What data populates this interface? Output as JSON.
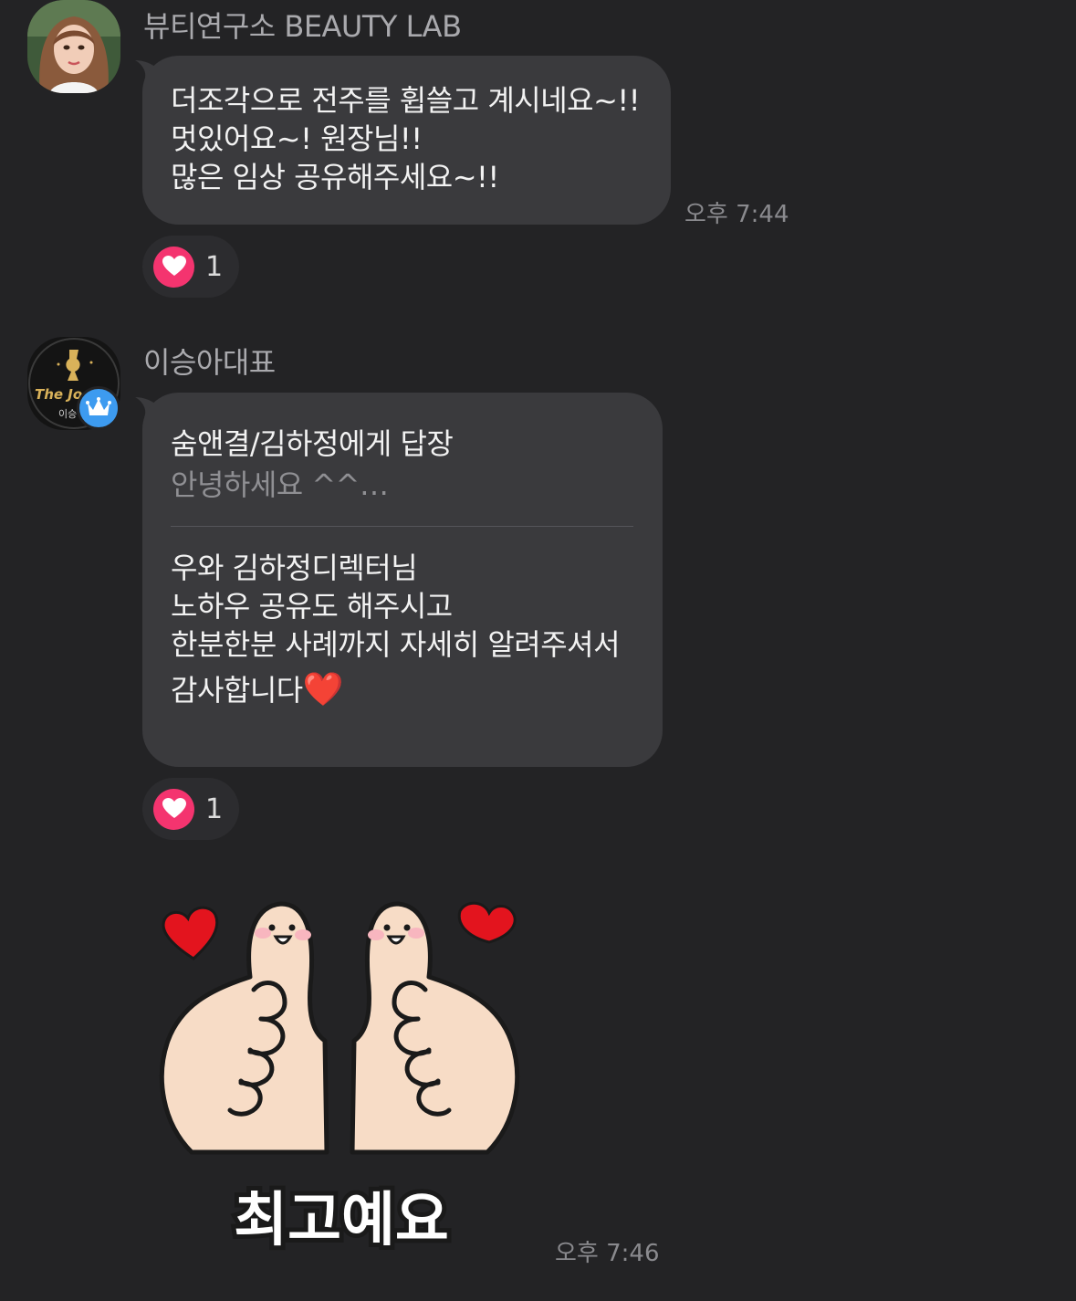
{
  "messages": [
    {
      "sender": "뷰티연구소 BEAUTY LAB",
      "lines": [
        "더조각으로 전주를 휩쓸고 계시네요~!!",
        "멋있어요~! 원장님!!",
        "많은 임상 공유해주세요~!!"
      ],
      "time": "오후 7:44",
      "reaction": {
        "icon": "heart-icon",
        "count": "1"
      }
    },
    {
      "sender": "이승아대표",
      "reply_to": "숨앤결/김하정에게 답장",
      "reply_preview": "안녕하세요 ^^…",
      "lines": [
        "우와 김하정디렉터님",
        "노하우 공유도 해주시고",
        "한분한분 사례까지 자세히 알려주셔서",
        "감사합니다"
      ],
      "emoji": "❤️",
      "reaction": {
        "icon": "heart-icon",
        "count": "1"
      }
    },
    {
      "sticker": {
        "caption": "최고예요",
        "icon": "thumbs-up-sticker"
      },
      "time": "오후 7:46"
    }
  ],
  "colors": {
    "background": "#232325",
    "bubble": "#3a3a3d",
    "reaction_heart": "#f4346f",
    "badge": "#3d9bf0"
  }
}
